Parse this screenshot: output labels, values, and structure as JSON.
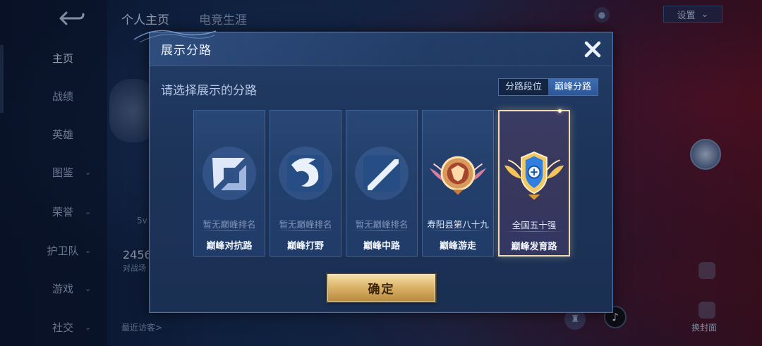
{
  "background": {
    "nav_items": [
      {
        "label": "主页",
        "active": true,
        "chevron": false
      },
      {
        "label": "战绩",
        "active": false,
        "chevron": false
      },
      {
        "label": "英雄",
        "active": false,
        "chevron": false
      },
      {
        "label": "图鉴",
        "active": false,
        "chevron": true
      },
      {
        "label": "荣誉",
        "active": false,
        "chevron": true
      },
      {
        "label": "护卫队",
        "active": false,
        "chevron": true
      },
      {
        "label": "游戏",
        "active": false,
        "chevron": true
      },
      {
        "label": "社交",
        "active": false,
        "chevron": true
      }
    ],
    "top_tab_1": "个人主页",
    "top_tab_2": "电竞生涯",
    "settings_label": "设置",
    "settings_chevron": "⌄",
    "stat_number": "2456",
    "stat_label": "对战场",
    "mode_label": "5v",
    "visitors_label": "最近访客>",
    "swap_cover_label": "换封面"
  },
  "modal": {
    "title": "展示分路",
    "prompt": "请选择展示的分路",
    "toggle": [
      "分路段位",
      "巅峰分路"
    ],
    "toggle_active_index": 1,
    "cards": [
      {
        "rank": "暂无巅峰排名",
        "name": "巅峰对抗路",
        "icon": "clash-lane-icon",
        "has_rank": false
      },
      {
        "rank": "暂无巅峰排名",
        "name": "巅峰打野",
        "icon": "jungle-icon",
        "has_rank": false
      },
      {
        "rank": "暂无巅峰排名",
        "name": "巅峰中路",
        "icon": "mid-lane-icon",
        "has_rank": false
      },
      {
        "rank": "寿阳县第八十九",
        "name": "巅峰游走",
        "icon": "roam-badge-icon",
        "has_rank": true
      },
      {
        "rank": "全国五十强",
        "name": "巅峰发育路",
        "icon": "farm-lane-badge-icon",
        "has_rank": true
      }
    ],
    "selected_card_index": 4,
    "confirm_label": "确定"
  },
  "colors": {
    "accent_blue": "#3d6db3",
    "gold_button": "#dcb56a",
    "selected_border": "#f0dcb0"
  }
}
